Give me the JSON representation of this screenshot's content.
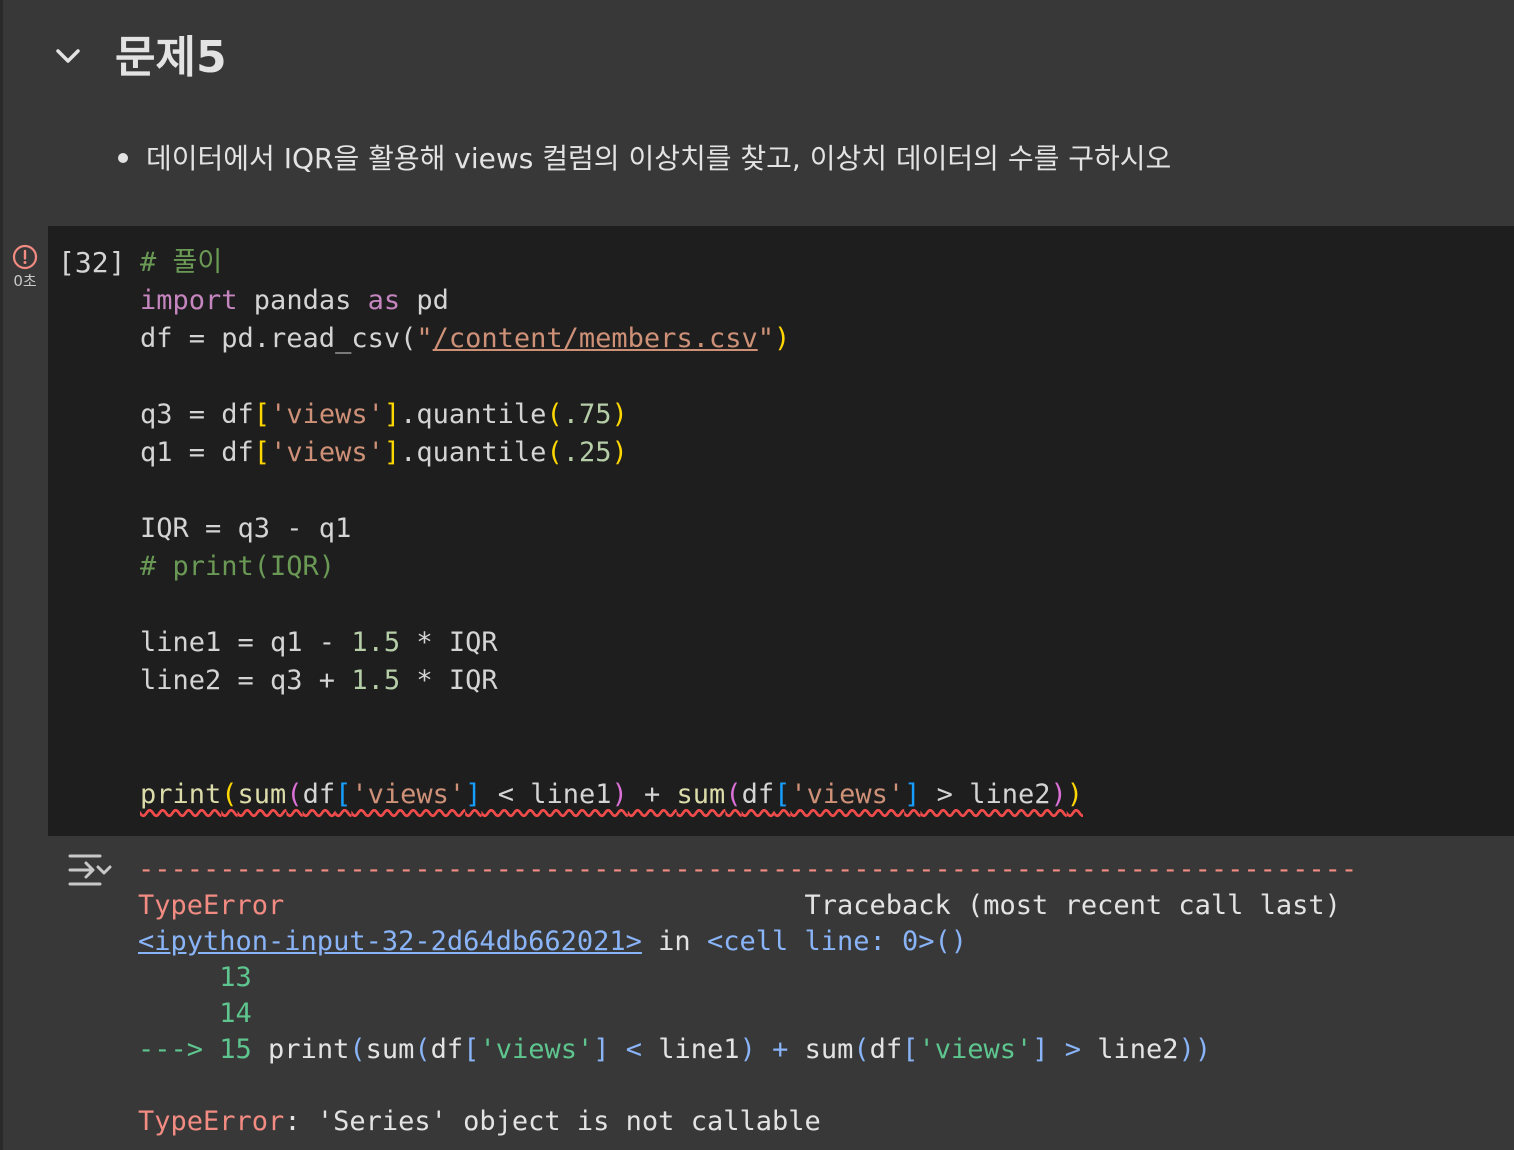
{
  "section": {
    "title": "문제5",
    "bullet": "데이터에서 IQR을 활용해 views 컬럼의 이상치를 찾고, 이상치 데이터의 수를 구하시오"
  },
  "cell": {
    "execution_count": "[32]",
    "exec_time": "0초",
    "code": {
      "l1_comment": "# 풀이",
      "l2_import": "import",
      "l2_pandas": " pandas ",
      "l2_as": "as",
      "l2_pd": " pd",
      "l3_pre": "df = pd.read_csv(",
      "l3_q1": "\"",
      "l3_path": "/content/members.csv",
      "l3_q2": "\"",
      "l3_close": ")",
      "l5_a": "q3 = df",
      "l5_lb": "[",
      "l5_str": "'views'",
      "l5_rb": "]",
      "l5_b": ".quantile",
      "l5_lp": "(",
      "l5_num": ".75",
      "l5_rp": ")",
      "l6_a": "q1 = df",
      "l6_lb": "[",
      "l6_str": "'views'",
      "l6_rb": "]",
      "l6_b": ".quantile",
      "l6_lp": "(",
      "l6_num": ".25",
      "l6_rp": ")",
      "l8": "IQR = q3 - q1",
      "l9_comment": "# print(IQR)",
      "l11_a": "line1 = q1 - ",
      "l11_num": "1.5",
      "l11_b": " * IQR",
      "l12_a": "line2 = q3 + ",
      "l12_num": "1.5",
      "l12_b": " * IQR",
      "l15_print": "print",
      "l15_lp1": "(",
      "l15_sum1": "sum",
      "l15_lp2": "(",
      "l15_df1": "df",
      "l15_lb1": "[",
      "l15_s1": "'views'",
      "l15_rb1": "]",
      "l15_mid1": " < line1",
      "l15_rp2": ")",
      "l15_plus": " + ",
      "l15_sum2": "sum",
      "l15_lp3": "(",
      "l15_df2": "df",
      "l15_lb2": "[",
      "l15_s2": "'views'",
      "l15_rb2": "]",
      "l15_mid2": " > line2",
      "l15_rp3": ")",
      "l15_rp1": ")"
    }
  },
  "output": {
    "dashes": "---------------------------------------------------------------------------",
    "error_name": "TypeError",
    "traceback_header": "Traceback (most recent call last)",
    "input_link": "<ipython-input-32-2d64db662021>",
    "in_word": " in ",
    "cell_line": "<cell line: 0>()",
    "line13": "13",
    "line14": "14",
    "arrow": "---> ",
    "line15": "15",
    "tb_print": " print",
    "tb_lp1": "(",
    "tb_sum1": "sum",
    "tb_lp2": "(",
    "tb_df1": "df",
    "tb_lb1": "[",
    "tb_s1": "'views'",
    "tb_rb1": "]",
    "tb_lt": " < ",
    "tb_line1": "line1",
    "tb_rp2": ")",
    "tb_plus": " + ",
    "tb_sum2": "sum",
    "tb_lp3": "(",
    "tb_df2": "df",
    "tb_lb2": "[",
    "tb_s2": "'views'",
    "tb_rb2": "]",
    "tb_gt": " > ",
    "tb_line2": "line2",
    "tb_rp3": "))",
    "final_error": "TypeError",
    "final_msg": ": 'Series' object is not callable"
  },
  "icons": {
    "collapse": "chevron-down-icon",
    "error": "error-circle-icon",
    "output_toggle": "output-collapse-icon"
  },
  "colors": {
    "background": "#383838",
    "code_bg": "#1e1e1e",
    "error_red": "#f28b82",
    "link_blue": "#8ab4f8",
    "line_green": "#5ec58e"
  }
}
